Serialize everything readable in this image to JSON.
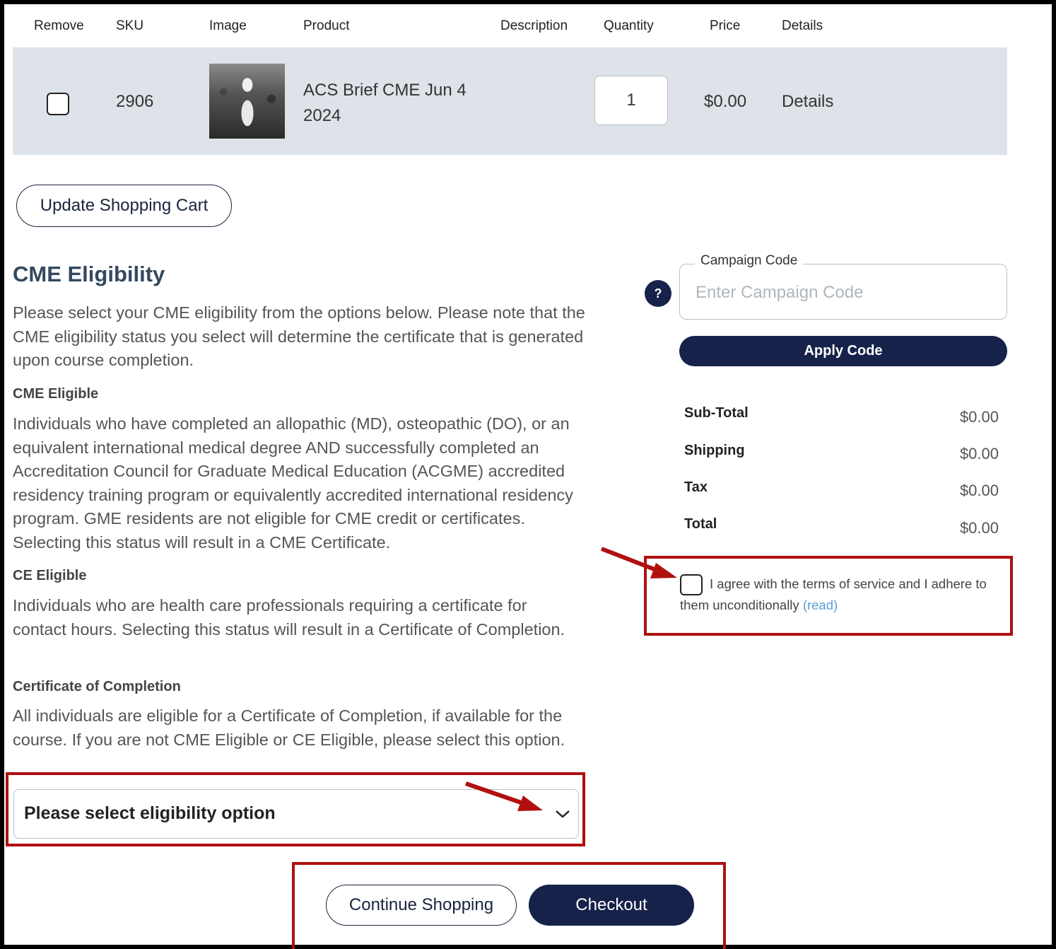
{
  "table": {
    "headers": [
      "Remove",
      "SKU",
      "Image",
      "Product",
      "Description",
      "Quantity",
      "Price",
      "Details"
    ],
    "row": {
      "sku": "2906",
      "product_line1": "ACS Brief CME Jun 4",
      "product_line2": "2024",
      "quantity": "1",
      "price": "$0.00",
      "details_label": "Details"
    }
  },
  "update_cart_label": "Update Shopping Cart",
  "eligibility": {
    "title": "CME Eligibility",
    "intro": "Please select your CME eligibility from the options below. Please note that the CME eligibility status you select will determine the certificate that is generated upon course completion.",
    "cme_title": "CME Eligible",
    "cme_text": "Individuals who have completed an allopathic (MD), osteopathic (DO), or an equivalent international medical degree AND successfully completed an Accreditation Council for Graduate Medical Education (ACGME) accredited residency training program or equivalently accredited international residency program. GME residents are not eligible for CME credit or certificates. Selecting this status will result in a CME Certificate.",
    "ce_title": "CE Eligible",
    "ce_text": "Individuals who are health care professionals requiring a certificate for contact hours. Selecting this status will result in a Certificate of Completion.",
    "coc_title": "Certificate of Completion",
    "coc_text": "All individuals are eligible for a Certificate of Completion, if available for the course. If you are not CME Eligible or CE Eligible, please select this option.",
    "select_value": "Please select eligibility option"
  },
  "campaign": {
    "help_label": "?",
    "legend": "Campaign Code",
    "placeholder": "Enter Campaign Code",
    "apply_label": "Apply Code"
  },
  "totals": {
    "subtotal_label": "Sub-Total",
    "subtotal": "$0.00",
    "shipping_label": "Shipping",
    "shipping": "$0.00",
    "tax_label": "Tax",
    "tax": "$0.00",
    "total_label": "Total",
    "total": "$0.00"
  },
  "terms": {
    "text": "I agree with the terms of service and I adhere to them unconditionally",
    "read_link": "(read)"
  },
  "actions": {
    "continue_label": "Continue Shopping",
    "checkout_label": "Checkout"
  },
  "colors": {
    "accent": "#16224a",
    "annotation": "#b01010",
    "row_bg": "#dde3e8",
    "link": "#5b9ed6"
  }
}
